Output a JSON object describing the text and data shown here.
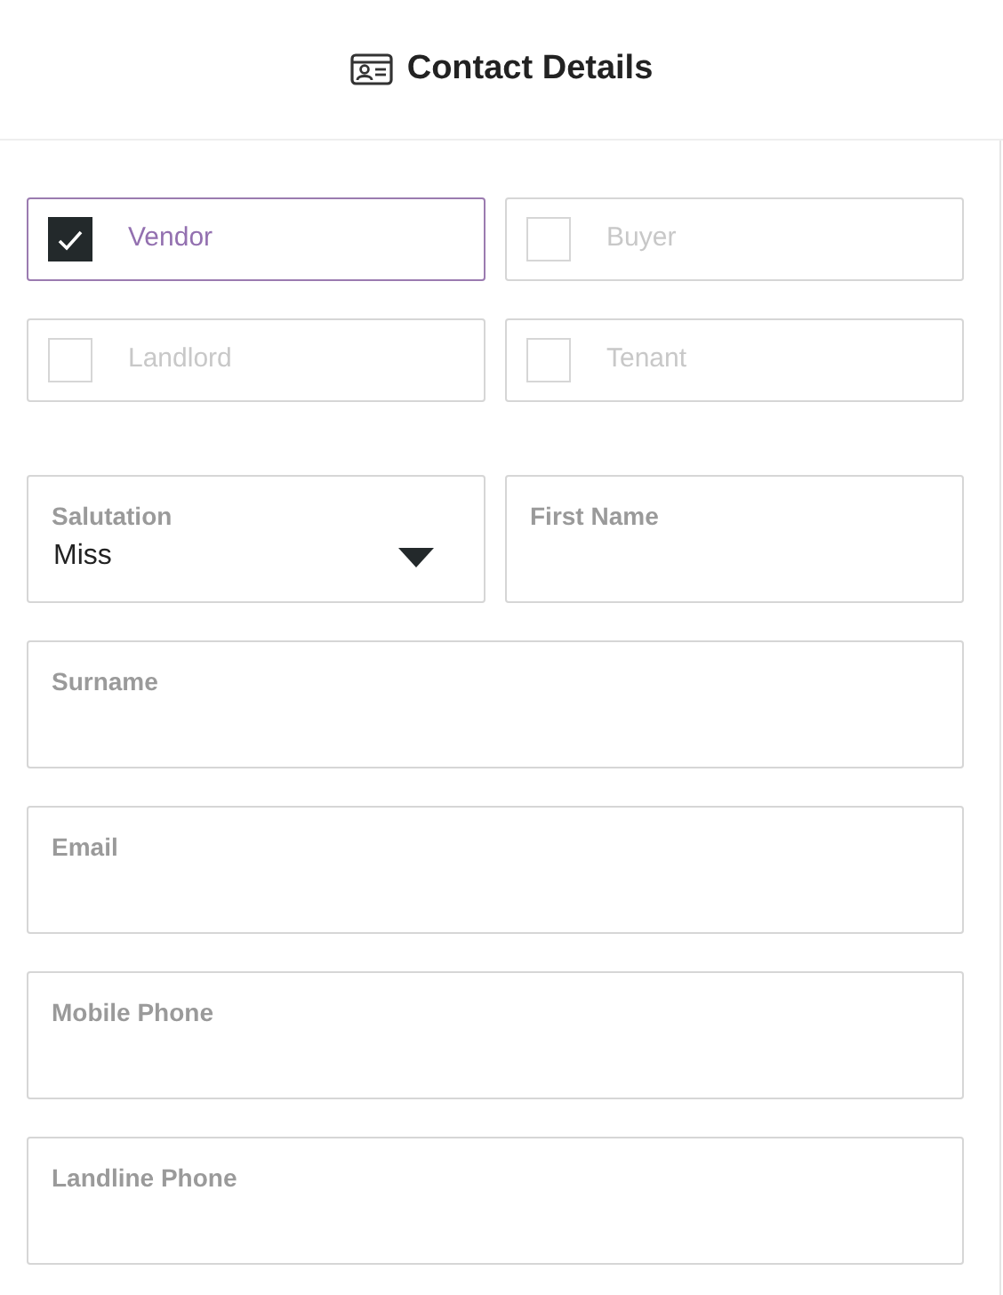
{
  "header": {
    "title": "Contact Details"
  },
  "roles": [
    {
      "label": "Vendor",
      "checked": true
    },
    {
      "label": "Buyer",
      "checked": false
    },
    {
      "label": "Landlord",
      "checked": false
    },
    {
      "label": "Tenant",
      "checked": false
    }
  ],
  "field_rows": [
    [
      {
        "kind": "select",
        "label": "Salutation",
        "value": "Miss"
      },
      {
        "kind": "text",
        "label": "First Name"
      }
    ],
    [
      {
        "kind": "text",
        "label": "Surname"
      }
    ],
    [
      {
        "kind": "text",
        "label": "Email"
      }
    ],
    [
      {
        "kind": "text",
        "label": "Mobile Phone"
      }
    ],
    [
      {
        "kind": "text",
        "label": "Landline Phone"
      }
    ]
  ]
}
